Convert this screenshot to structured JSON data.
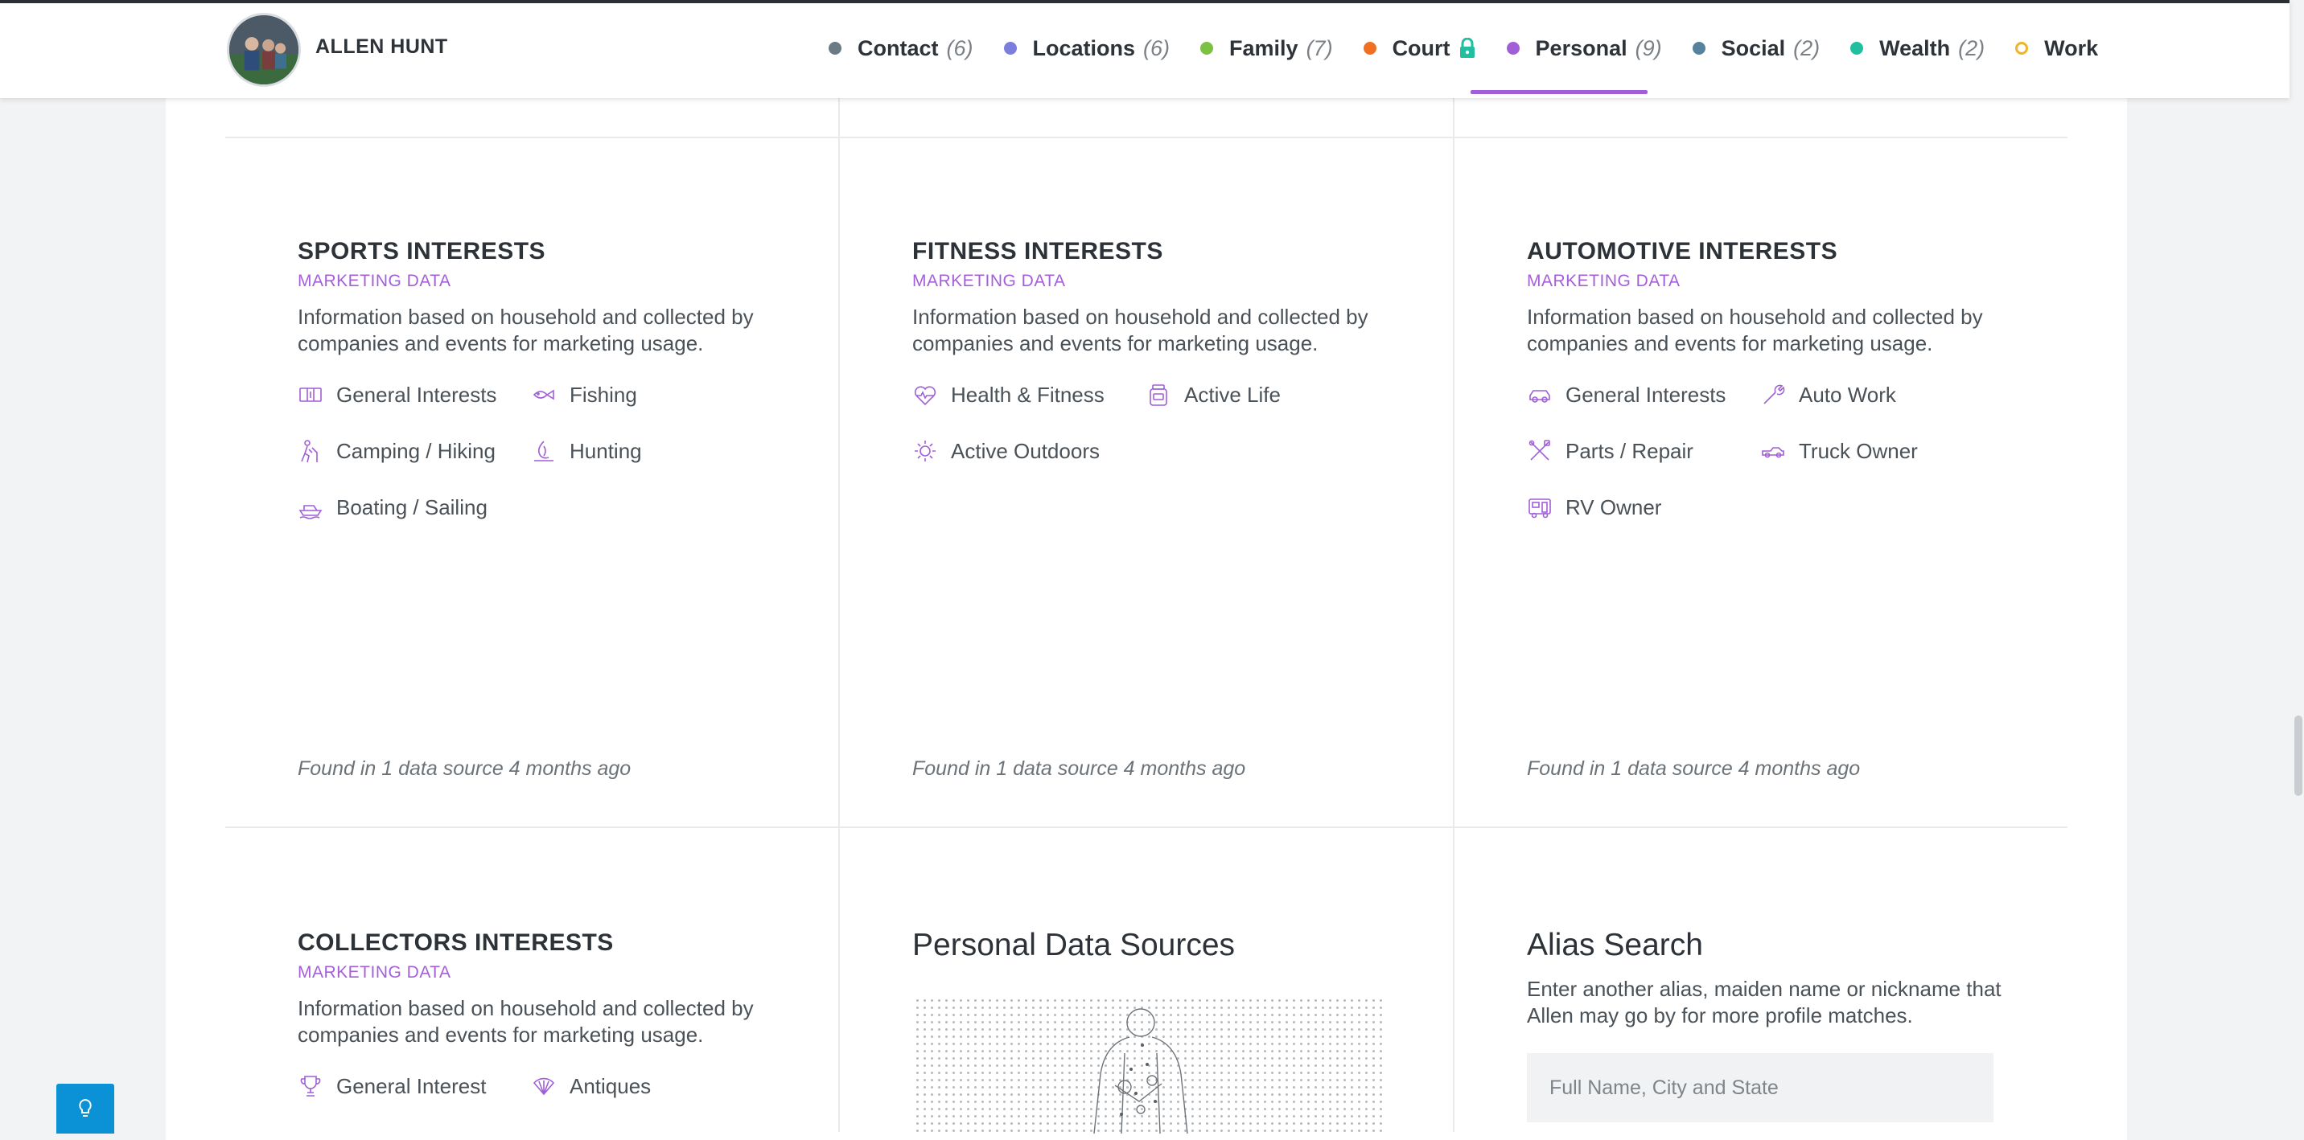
{
  "profile": {
    "name": "ALLEN HUNT"
  },
  "nav": [
    {
      "label": "Contact",
      "count": "(6)",
      "color": "#6b7b86"
    },
    {
      "label": "Locations",
      "count": "(6)",
      "color": "#7b7fdb"
    },
    {
      "label": "Family",
      "count": "(7)",
      "color": "#7bc143"
    },
    {
      "label": "Court",
      "count": "",
      "color": "#f06f22"
    },
    {
      "label": "Personal",
      "count": "(9)",
      "color": "#a05fd8"
    },
    {
      "label": "Social",
      "count": "(2)",
      "color": "#56829e"
    },
    {
      "label": "Wealth",
      "count": "(2)",
      "color": "#1fbfa0"
    },
    {
      "label": "Work",
      "count": "",
      "color": "#f0b429"
    }
  ],
  "active_tab": "Personal",
  "cards": {
    "sports": {
      "title": "SPORTS INTERESTS",
      "subtitle": "MARKETING DATA",
      "description": "Information based on household and collected by companies and events for marketing usage.",
      "tags": [
        "General Interests",
        "Fishing",
        "Camping / Hiking",
        "Hunting",
        "Boating / Sailing"
      ],
      "footer": "Found in 1 data source 4 months ago"
    },
    "fitness": {
      "title": "FITNESS INTERESTS",
      "subtitle": "MARKETING DATA",
      "description": "Information based on household and collected by companies and events for marketing usage.",
      "tags": [
        "Health & Fitness",
        "Active Life",
        "Active Outdoors"
      ],
      "footer": "Found in 1 data source 4 months ago"
    },
    "automotive": {
      "title": "AUTOMOTIVE INTERESTS",
      "subtitle": "MARKETING DATA",
      "description": "Information based on household and collected by companies and events for marketing usage.",
      "tags": [
        "General Interests",
        "Auto Work",
        "Parts / Repair",
        "Truck Owner",
        "RV Owner"
      ],
      "footer": "Found in 1 data source 4 months ago"
    },
    "collectors": {
      "title": "COLLECTORS INTERESTS",
      "subtitle": "MARKETING DATA",
      "description": "Information based on household and collected by companies and events for marketing usage.",
      "tags": [
        "General Interest",
        "Antiques"
      ]
    }
  },
  "personal_sources": {
    "title": "Personal Data Sources"
  },
  "alias_search": {
    "title": "Alias Search",
    "description": "Enter another alias, maiden name or nickname that Allen may go by for more profile matches.",
    "placeholder": "Full Name, City and State"
  },
  "icons": {
    "accent": "#a05fd8",
    "help": "lightbulb-icon"
  }
}
